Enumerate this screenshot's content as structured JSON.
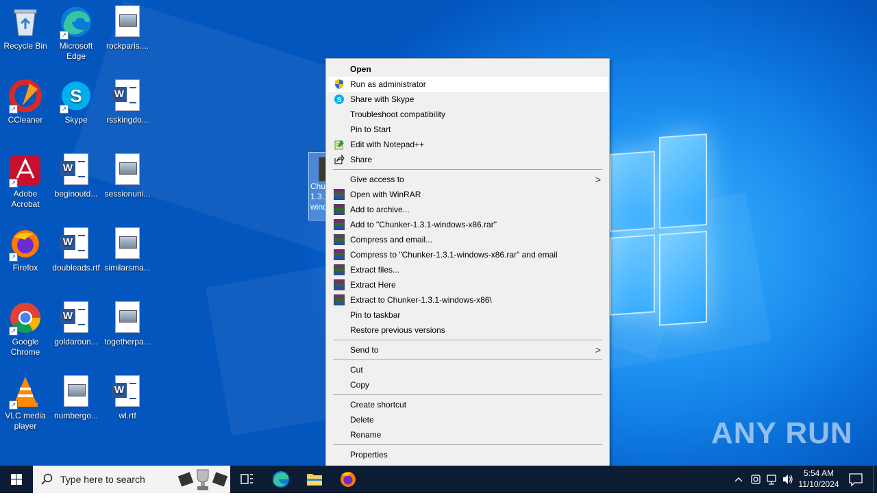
{
  "desktop": {
    "icons": [
      {
        "label": "Recycle Bin",
        "icon": "recycle-bin-icon"
      },
      {
        "label": "Microsoft Edge",
        "icon": "edge-icon"
      },
      {
        "label": "rockparis....",
        "icon": "image-file-icon"
      },
      {
        "label": "CCleaner",
        "icon": "ccleaner-icon"
      },
      {
        "label": "Skype",
        "icon": "skype-icon"
      },
      {
        "label": "rsskingdo...",
        "icon": "word-doc-icon"
      },
      {
        "label": "Adobe Acrobat",
        "icon": "acrobat-icon"
      },
      {
        "label": "beginoutd...",
        "icon": "word-doc-icon"
      },
      {
        "label": "sessionuni...",
        "icon": "image-file-icon"
      },
      {
        "label": "Firefox",
        "icon": "firefox-icon"
      },
      {
        "label": "doubleads.rtf",
        "icon": "word-doc-icon"
      },
      {
        "label": "similarsma...",
        "icon": "image-file-icon"
      },
      {
        "label": "Google Chrome",
        "icon": "chrome-icon"
      },
      {
        "label": "goldaroun...",
        "icon": "word-doc-icon"
      },
      {
        "label": "togetherpa...",
        "icon": "image-file-icon"
      },
      {
        "label": "VLC media player",
        "icon": "vlc-icon"
      },
      {
        "label": "numbergo...",
        "icon": "image-file-icon"
      },
      {
        "label": "wl.rtf",
        "icon": "word-doc-icon"
      }
    ],
    "selected_file_label": "Chunker-1.3.1-windows-x86"
  },
  "context_menu": {
    "items": [
      {
        "label": "Open",
        "bold": true,
        "icon": ""
      },
      {
        "label": "Run as administrator",
        "icon": "shield-icon",
        "highlighted": true
      },
      {
        "label": "Share with Skype",
        "icon": "skype-icon"
      },
      {
        "label": "Troubleshoot compatibility",
        "icon": ""
      },
      {
        "label": "Pin to Start",
        "icon": ""
      },
      {
        "label": "Edit with Notepad++",
        "icon": "notepadpp-icon"
      },
      {
        "label": "Share",
        "icon": "share-icon"
      },
      {
        "label": "Give access to",
        "icon": "",
        "submenu": true
      },
      {
        "label": "Open with WinRAR",
        "icon": "winrar-icon"
      },
      {
        "label": "Add to archive...",
        "icon": "winrar-icon"
      },
      {
        "label": "Add to \"Chunker-1.3.1-windows-x86.rar\"",
        "icon": "winrar-icon"
      },
      {
        "label": "Compress and email...",
        "icon": "winrar-icon"
      },
      {
        "label": "Compress to \"Chunker-1.3.1-windows-x86.rar\" and email",
        "icon": "winrar-icon"
      },
      {
        "label": "Extract files...",
        "icon": "winrar-icon"
      },
      {
        "label": "Extract Here",
        "icon": "winrar-icon"
      },
      {
        "label": "Extract to Chunker-1.3.1-windows-x86\\",
        "icon": "winrar-icon"
      },
      {
        "label": "Pin to taskbar",
        "icon": ""
      },
      {
        "label": "Restore previous versions",
        "icon": ""
      },
      {
        "label": "Send to",
        "icon": "",
        "submenu": true
      },
      {
        "label": "Cut",
        "icon": ""
      },
      {
        "label": "Copy",
        "icon": ""
      },
      {
        "label": "Create shortcut",
        "icon": ""
      },
      {
        "label": "Delete",
        "icon": ""
      },
      {
        "label": "Rename",
        "icon": ""
      },
      {
        "label": "Properties",
        "icon": ""
      }
    ],
    "submenu_arrow": ">"
  },
  "taskbar": {
    "search_placeholder": "Type here to search",
    "pinned": [
      "task-view-icon",
      "edge-icon",
      "file-explorer-icon",
      "firefox-icon"
    ],
    "time": "5:54 AM",
    "date": "11/10/2024"
  },
  "watermark": "ANY RUN"
}
